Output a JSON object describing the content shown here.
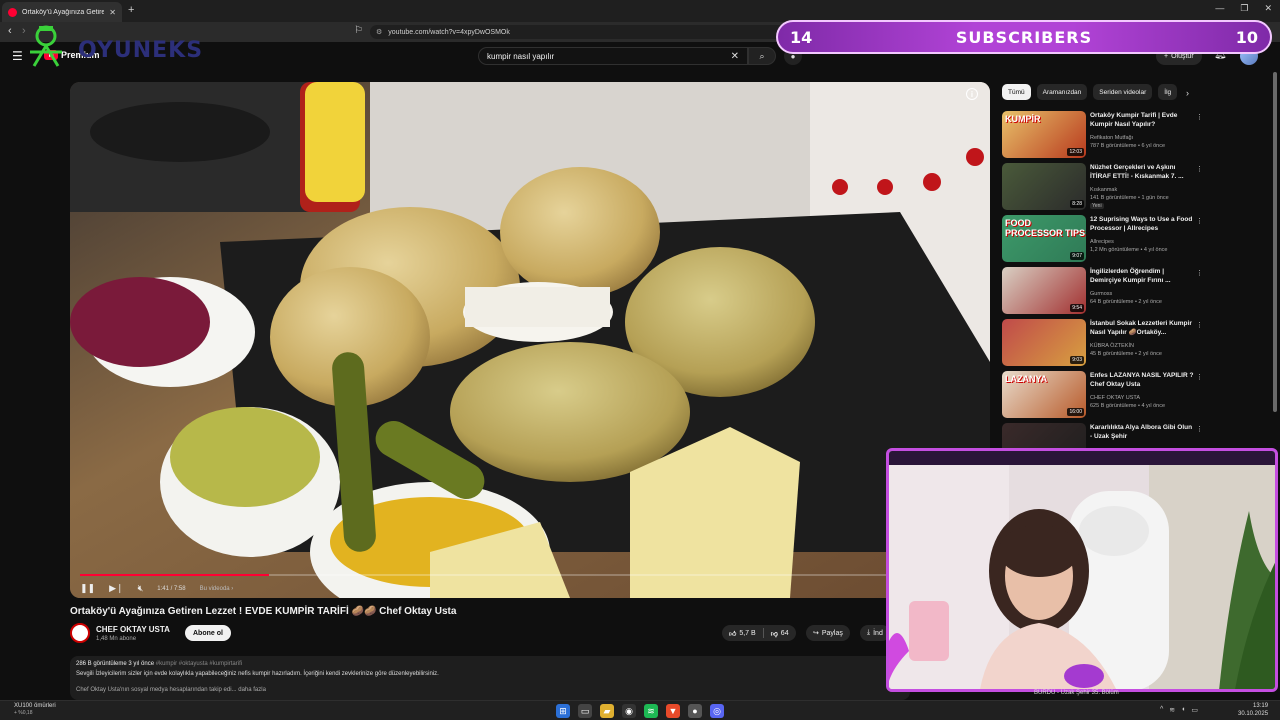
{
  "browser": {
    "tab_title": "Ortaköy'ü Ayağınıza Getiren Lez...",
    "url": "youtube.com/watch?v=4xpyDwOSMOk"
  },
  "youtube": {
    "logo_text": "Premium",
    "search_value": "kumpir nasıl yapılır",
    "create_label": "Oluştur"
  },
  "overlay": {
    "brand_text": "OYUNEKS",
    "sub_left": "14",
    "sub_label": "SUBSCRIBERS",
    "sub_right": "10"
  },
  "player": {
    "time": "1:41 / 7:58",
    "chapter": "Bu videoda ›",
    "progress": 0.21
  },
  "video": {
    "title": "Ortaköy'ü Ayağınıza Getiren Lezzet ! EVDE KUMPİR TARİFİ 🥔🥔 Chef Oktay Usta",
    "channel": "CHEF OKTAY USTA",
    "subscribers": "1,48 Mn abone",
    "subscribe_label": "Abone ol",
    "likes": "5,7 B",
    "dislikes": "64",
    "share_label": "Paylaş",
    "download_label": "İnd",
    "desc_views": "286 B görüntüleme  3 yıl önce",
    "desc_tags": "#kumpir #oktayusta #kumpirtarifi",
    "desc_line": "Sevgili İzleyicilerim sizler için evde kolaylıkla yapabileceğiniz nefis kumpir hazırladım. İçeriğini kendi zevklerinize göre düzenleyebilirsiniz.",
    "desc_line2": "Chef Oktay Usta'nın sosyal medya hesaplarından takip edi...  daha fazla"
  },
  "chips": [
    "Tümü",
    "Aramanızdan",
    "Seriden videolar",
    "İlg"
  ],
  "recommendations": [
    {
      "title": "Ortaköy Kumpir Tarifi | Evde Kumpir Nasıl Yapılır?",
      "channel": "Refikaton Mutfağı",
      "meta": "787 B görüntüleme • 6 yıl önce",
      "duration": "12:03",
      "label": "KUMPİR",
      "color1": "#e8c16a",
      "color2": "#b83a1e",
      "badge": ""
    },
    {
      "title": "Nüzhet Gerçekleri ve Aşkını İTİRAF ETTİ! - Kıskanmak 7. ...",
      "channel": "Kıskanmak",
      "meta": "141 B görüntüleme • 1 gün önce",
      "duration": "8:28",
      "label": "",
      "color1": "#4a5a3a",
      "color2": "#2b2b2b",
      "badge": "Yeni"
    },
    {
      "title": "12 Suprising Ways to Use a Food Processor | Allrecipes",
      "channel": "Allrecipes",
      "meta": "1,2 Mn görüntüleme • 4 yıl önce",
      "duration": "9:07",
      "label": "FOOD PROCESSOR TIPS",
      "color1": "#3d9a6a",
      "color2": "#2f7a56",
      "badge": ""
    },
    {
      "title": "İngilizlerden Öğrendim | Demirçiye Kumpir Fırını ...",
      "channel": "Gurmoss",
      "meta": "64 B görüntüleme • 2 yıl önce",
      "duration": "9:54",
      "label": "",
      "color1": "#d9d0c4",
      "color2": "#a23030",
      "badge": ""
    },
    {
      "title": "İstanbul Sokak Lezzetleri Kumpir Nasıl Yapılır 🥔Ortaköy...",
      "channel": "KÜBRA ÖZTEKİN",
      "meta": "45 B görüntüleme • 2 yıl önce",
      "duration": "9:03",
      "label": "",
      "color1": "#c04a4a",
      "color2": "#d8a040",
      "badge": ""
    },
    {
      "title": "Enfes LAZANYA NASIL YAPILIR ? Chef Oktay Usta",
      "channel": "CHEF OKTAY USTA",
      "meta": "625 B görüntüleme • 4 yıl önce",
      "duration": "16:00",
      "label": "LAZANYA",
      "color1": "#e8dccc",
      "color2": "#b85a2a",
      "badge": ""
    },
    {
      "title": "Kararlılıkta Alya Albora Gibi Olun - Uzak Şehir",
      "channel": "",
      "meta": "",
      "duration": "",
      "label": "",
      "color1": "#3a2a2a",
      "color2": "#1e1e1e",
      "badge": ""
    }
  ],
  "bottom_peek": "BÜRDÜ - Uzak Şehir 35. Bölüm",
  "taskbar": {
    "weather_title": "XU100 ömürleri",
    "weather_sub": "+ %0,18",
    "time": "13:19",
    "date": "30.10.2025"
  },
  "icons": {
    "hamburger": "menu-icon",
    "search": "search-icon",
    "mic": "mic-icon",
    "bell": "bell-icon"
  }
}
